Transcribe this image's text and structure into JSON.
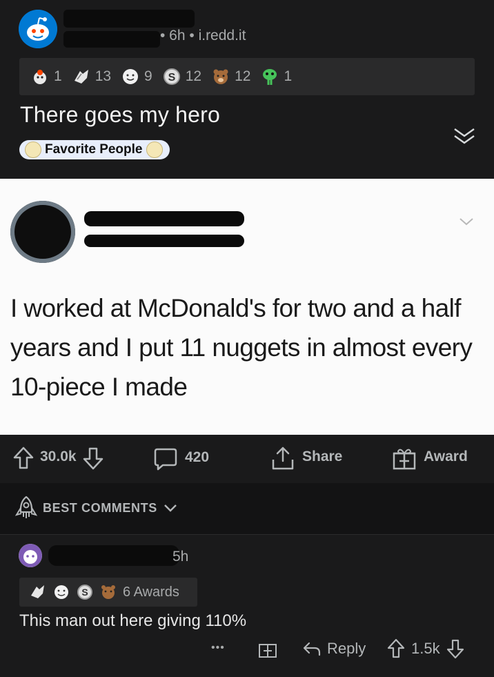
{
  "post": {
    "meta": "• 6h • i.redd.it",
    "awards": [
      {
        "icon": "rocket-like-icon",
        "count": "1"
      },
      {
        "icon": "hands-icon",
        "count": "13"
      },
      {
        "icon": "wholesome-icon",
        "count": "9"
      },
      {
        "icon": "silver-s-icon",
        "count": "12"
      },
      {
        "icon": "bear-icon",
        "count": "12"
      },
      {
        "icon": "green-alien-icon",
        "count": "1"
      }
    ],
    "title": "There goes my hero",
    "flair": "Favorite People"
  },
  "tweet": {
    "text": "I worked at McDonald's for two and a half years and I put 11 nuggets in almost every 10-piece I made"
  },
  "actions": {
    "upvotes": "30.0k",
    "comments": "420",
    "share": "Share",
    "award": "Award"
  },
  "comments_header": {
    "sort_label": "BEST COMMENTS"
  },
  "comment": {
    "meta": "5h",
    "awards_label": "6 Awards",
    "text": "This man out here giving 110%",
    "more": "•••",
    "reply": "Reply",
    "score": "1.5k"
  },
  "colors": {
    "background": "#1a1a1b",
    "awards_bar": "#2a2a2b",
    "flair_bg": "#e8eefb",
    "tweet_bg": "#fbfbfb"
  }
}
